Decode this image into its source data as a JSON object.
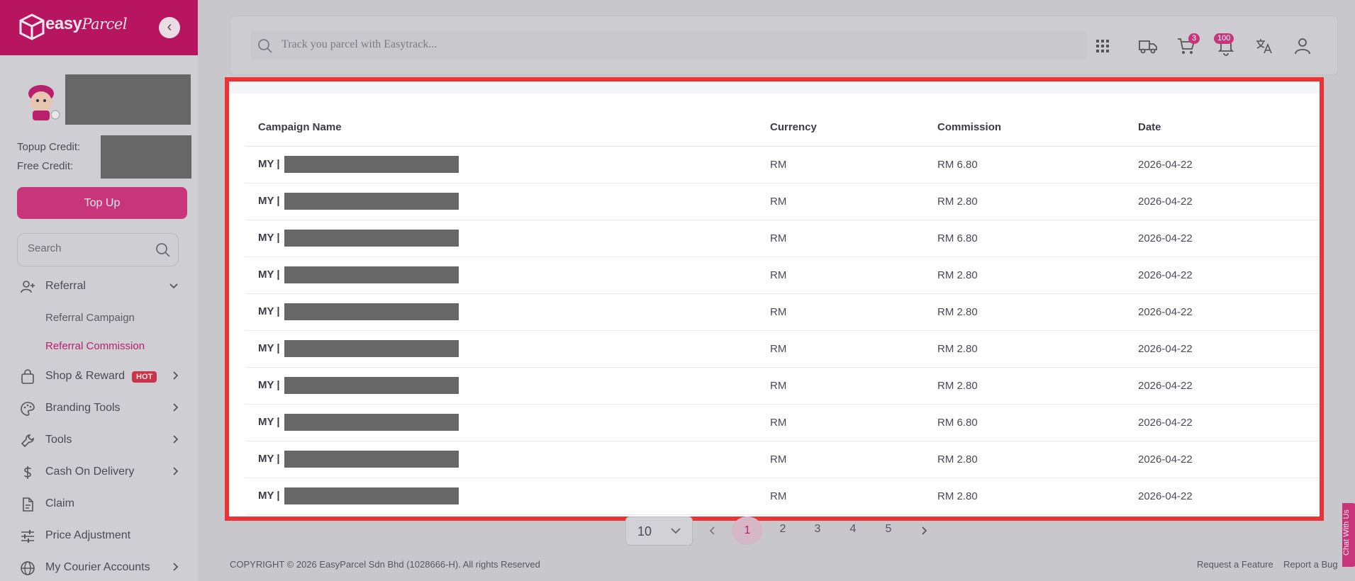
{
  "brand": {
    "name": "easy",
    "script": "Parcel",
    "color": "#b7155f",
    "accent": "#c8357a"
  },
  "sidebar": {
    "credits": {
      "topup_label": "Topup Credit:",
      "free_label": "Free Credit:"
    },
    "topup_button": "Top Up",
    "search_placeholder": "Search",
    "items": [
      {
        "label": "Referral",
        "icon": "user-plus-icon",
        "chevron": "down"
      },
      {
        "label": "Shop & Reward",
        "icon": "shopping-bag-icon",
        "chevron": "right",
        "badge": "HOT"
      },
      {
        "label": "Branding Tools",
        "icon": "palette-icon",
        "chevron": "right"
      },
      {
        "label": "Tools",
        "icon": "wrench-icon",
        "chevron": "right"
      },
      {
        "label": "Cash On Delivery",
        "icon": "dollar-icon",
        "chevron": "right"
      },
      {
        "label": "Claim",
        "icon": "document-icon"
      },
      {
        "label": "Price Adjustment",
        "icon": "sliders-icon"
      },
      {
        "label": "My Courier Accounts",
        "icon": "globe-icon",
        "chevron": "right"
      }
    ],
    "referral_sub": [
      "Referral Campaign",
      "Referral Commission"
    ]
  },
  "topbar": {
    "track_placeholder": "Track you parcel with Easytrack...",
    "cart_badge": "3",
    "notification_badge": "100"
  },
  "table": {
    "headers": [
      "Campaign Name",
      "Currency",
      "Commission",
      "Date"
    ],
    "rows": [
      {
        "campaign": "MY |",
        "currency": "RM",
        "commission": "RM 6.80",
        "date": "2026-04-22"
      },
      {
        "campaign": "MY |",
        "currency": "RM",
        "commission": "RM 2.80",
        "date": "2026-04-22"
      },
      {
        "campaign": "MY |",
        "currency": "RM",
        "commission": "RM 6.80",
        "date": "2026-04-22"
      },
      {
        "campaign": "MY |",
        "currency": "RM",
        "commission": "RM 2.80",
        "date": "2026-04-22"
      },
      {
        "campaign": "MY |",
        "currency": "RM",
        "commission": "RM 2.80",
        "date": "2026-04-22"
      },
      {
        "campaign": "MY |",
        "currency": "RM",
        "commission": "RM 2.80",
        "date": "2026-04-22"
      },
      {
        "campaign": "MY |",
        "currency": "RM",
        "commission": "RM 2.80",
        "date": "2026-04-22"
      },
      {
        "campaign": "MY |",
        "currency": "RM",
        "commission": "RM 6.80",
        "date": "2026-04-22"
      },
      {
        "campaign": "MY |",
        "currency": "RM",
        "commission": "RM 2.80",
        "date": "2026-04-22"
      },
      {
        "campaign": "MY |",
        "currency": "RM",
        "commission": "RM 2.80",
        "date": "2026-04-22"
      }
    ]
  },
  "pagination": {
    "page_size": "10",
    "pages": [
      "1",
      "2",
      "3",
      "4",
      "5"
    ],
    "current": "1"
  },
  "footer": {
    "copyright": "COPYRIGHT © 2026 EasyParcel Sdn Bhd (1028666-H). All rights Reserved",
    "links": [
      "Request a Feature",
      "Report a Bug"
    ]
  },
  "chat_tab": "Chat With Us"
}
